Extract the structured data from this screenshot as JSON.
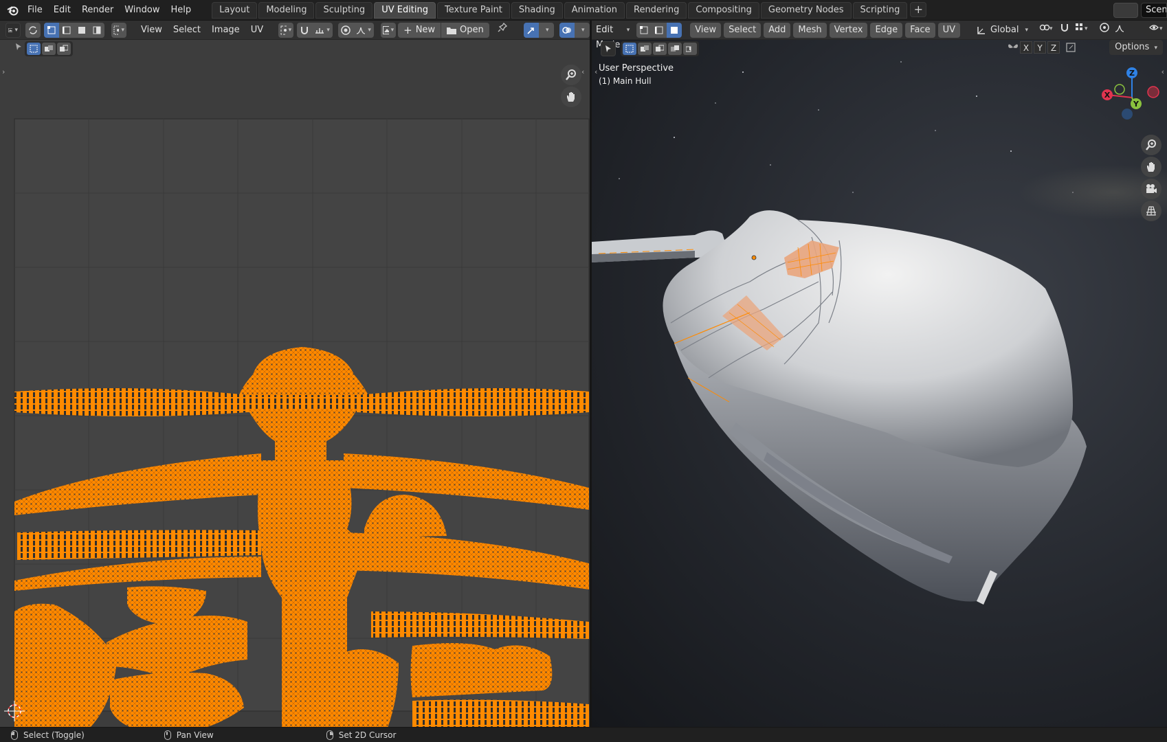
{
  "top_menu": [
    "File",
    "Edit",
    "Render",
    "Window",
    "Help"
  ],
  "workspaces": [
    {
      "label": "Layout",
      "active": false
    },
    {
      "label": "Modeling",
      "active": false
    },
    {
      "label": "Sculpting",
      "active": false
    },
    {
      "label": "UV Editing",
      "active": true
    },
    {
      "label": "Texture Paint",
      "active": false
    },
    {
      "label": "Shading",
      "active": false
    },
    {
      "label": "Animation",
      "active": false
    },
    {
      "label": "Rendering",
      "active": false
    },
    {
      "label": "Compositing",
      "active": false
    },
    {
      "label": "Geometry Nodes",
      "active": false
    },
    {
      "label": "Scripting",
      "active": false
    }
  ],
  "workspace_add": "+",
  "scene_name": "Scen",
  "uv_editor": {
    "menus": [
      "View",
      "Select",
      "Image",
      "UV"
    ],
    "new_label": "New",
    "open_label": "Open"
  },
  "viewport": {
    "mode": "Edit Mode",
    "menus": [
      "View",
      "Select",
      "Add",
      "Mesh",
      "Vertex",
      "Edge",
      "Face",
      "UV"
    ],
    "orientation": "Global",
    "axis_x": "X",
    "axis_y": "Y",
    "axis_z": "Z",
    "options_label": "Options",
    "perspective_label": "User Perspective",
    "object_label": "(1) Main Hull",
    "gizmo": {
      "x": "X",
      "y": "Y",
      "z": "Z"
    }
  },
  "status_bar": {
    "left_click": "Select (Toggle)",
    "middle_click": "Pan View",
    "right_click": "Set 2D Cursor"
  },
  "colors": {
    "accent": "#4772b3",
    "uv_selected": "#ff8a00",
    "axis_x": "#e0344f",
    "axis_y": "#8ac23e",
    "axis_z": "#2f82e6"
  }
}
